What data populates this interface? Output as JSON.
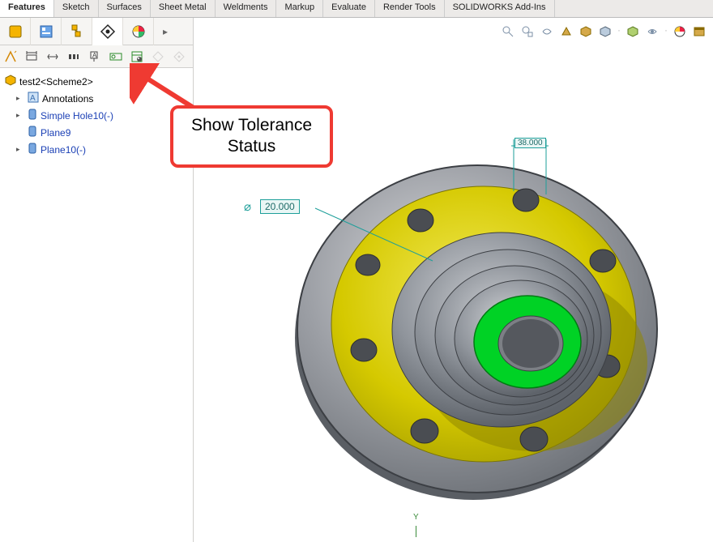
{
  "tabs": {
    "features": "Features",
    "sketch": "Sketch",
    "surfaces": "Surfaces",
    "sheet_metal": "Sheet Metal",
    "weldments": "Weldments",
    "markup": "Markup",
    "evaluate": "Evaluate",
    "render_tools": "Render Tools",
    "addins": "SOLIDWORKS Add-Ins"
  },
  "tree": {
    "root": "test2<Scheme2>",
    "annotations": "Annotations",
    "item1": "Simple Hole10(-)",
    "item2": "Plane9",
    "item3": "Plane10(-)"
  },
  "callout": {
    "line1": "Show Tolerance",
    "line2": "Status"
  },
  "dimensions": {
    "diameter": "20.000",
    "width": "38.000"
  },
  "axis": {
    "y_label": "Y"
  },
  "icons": {
    "panel": {
      "feature_mgr": "feature-manager",
      "property_mgr": "property-manager",
      "config_mgr": "configuration-manager",
      "dimxpert_mgr": "dimxpert-manager",
      "display_mgr": "display-manager"
    }
  }
}
